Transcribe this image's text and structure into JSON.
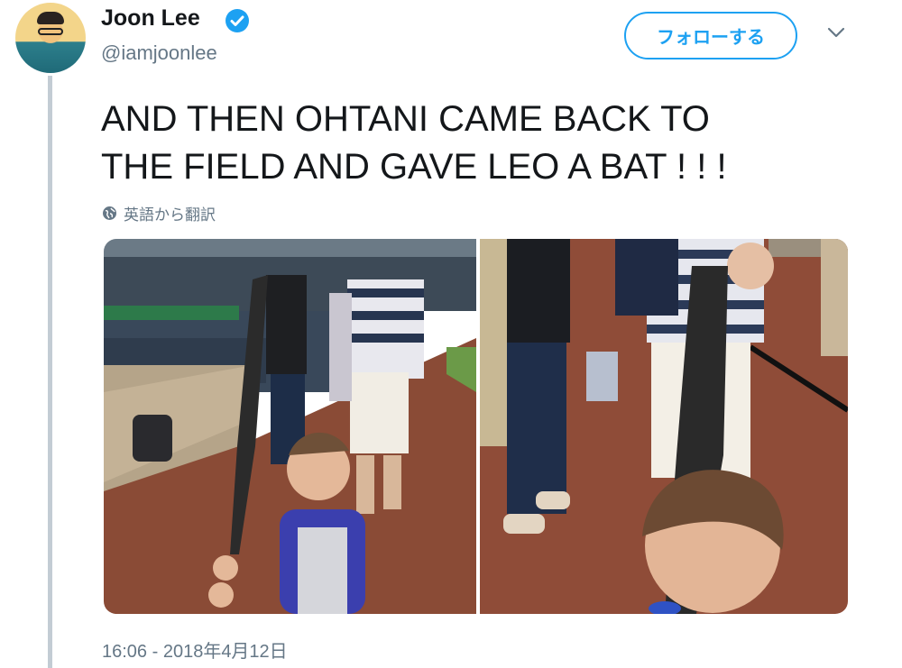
{
  "author": {
    "name": "Joon Lee",
    "handle": "@iamjoonlee",
    "verified": true
  },
  "follow_button": {
    "label": "フォローする"
  },
  "tweet": {
    "lines": [
      "AND THEN OHTANI CAME BACK TO",
      "THE FIELD AND GAVE LEO A BAT ! ! !"
    ],
    "translate_label": "英語から翻訳",
    "timestamp": "16:06 - 2018年4月12日"
  },
  "icons": {
    "verified": "verified-check-icon",
    "menu": "chevron-down-icon",
    "translate": "globe-icon"
  },
  "colors": {
    "accent": "#1da1f2",
    "secondary_text": "#657786",
    "thread_line": "#c3ccd4"
  },
  "media": {
    "photos": [
      {
        "description_name": "boy-with-bat-at-ballpark"
      },
      {
        "description_name": "boy-with-bat-closeup"
      }
    ]
  }
}
